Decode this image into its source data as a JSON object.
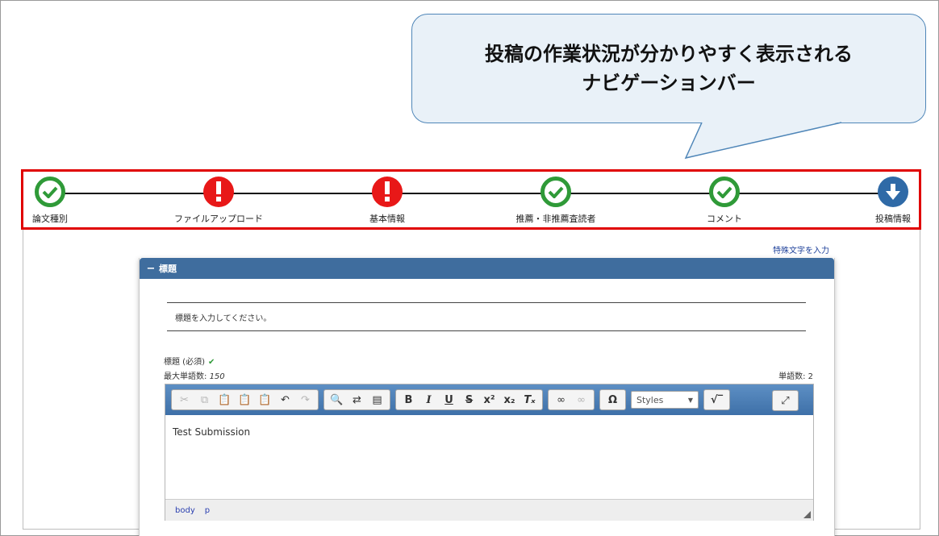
{
  "callout": {
    "line1": "投稿の作業状況が分かりやすく表示される",
    "line2": "ナビゲーションバー"
  },
  "nav": {
    "steps": [
      {
        "label": "論文種別",
        "status": "done",
        "icon": "check-icon"
      },
      {
        "label": "ファイルアップロード",
        "status": "warning",
        "icon": "exclamation-icon"
      },
      {
        "label": "基本情報",
        "status": "warning",
        "icon": "exclamation-icon"
      },
      {
        "label": "推薦・非推薦査読者",
        "status": "done",
        "icon": "check-icon"
      },
      {
        "label": "コメント",
        "status": "done",
        "icon": "check-icon"
      },
      {
        "label": "投稿情報",
        "status": "current",
        "icon": "arrow-down-icon"
      }
    ]
  },
  "special_chars_link": "特殊文字を入力",
  "panel": {
    "collapse_symbol": "−",
    "title": "標題",
    "instruction": "標題を入力してください。",
    "field_label": "標題 (必須)",
    "max_words_label": "最大単語数:",
    "max_words_value": "150",
    "word_count": "単語数: 2"
  },
  "editor": {
    "styles_label": "Styles",
    "content": "Test Submission",
    "path": [
      "body",
      "p"
    ]
  },
  "colors": {
    "done": "#2f9a38",
    "warning": "#e81818",
    "current": "#2f6aa7",
    "highlight_border": "#e00000",
    "panel_header": "#3f6d9e"
  }
}
